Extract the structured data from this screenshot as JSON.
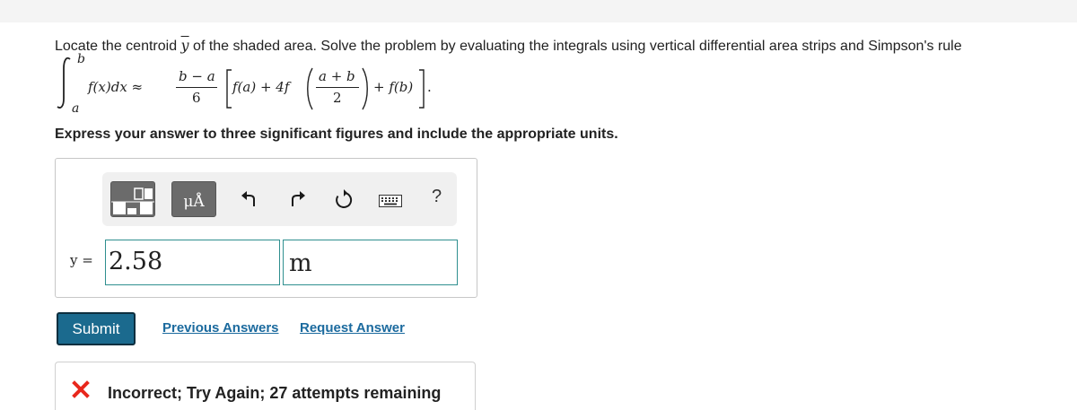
{
  "problem": {
    "prompt_before": "Locate the centroid ",
    "symbol": "y",
    "prompt_after": " of the shaded area. Solve the problem by evaluating the integrals using vertical differential area strips and Simpson's rule",
    "instructions": "Express your answer to three significant figures and include the appropriate units."
  },
  "formula": {
    "upper_limit": "b",
    "lower_limit": "a",
    "integrand": "f(x)dx ≈",
    "frac1_num": "b − a",
    "frac1_den": "6",
    "term1": "f(a) + 4f",
    "frac2_num": "a + b",
    "frac2_den": "2",
    "term2": "+ f(b)",
    "period": "."
  },
  "toolbar": {
    "templates_icon": "templates-icon",
    "units_label": "μÅ",
    "undo_icon": "undo-icon",
    "redo_icon": "redo-icon",
    "reset_icon": "reset-icon",
    "keyboard_icon": "keyboard-icon",
    "help_label": "?"
  },
  "answer": {
    "variable_label": "y =",
    "value": "2.58",
    "unit": "m"
  },
  "actions": {
    "submit_label": "Submit",
    "previous_answers_label": "Previous Answers",
    "request_answer_label": "Request Answer"
  },
  "feedback": {
    "icon": "x-mark-icon",
    "message": "Incorrect; Try Again; 27 attempts remaining",
    "icon_color": "#e8271c"
  },
  "colors": {
    "submit_bg": "#1b6a8e",
    "link": "#1b6a9e",
    "input_border": "#2f8f8f"
  }
}
